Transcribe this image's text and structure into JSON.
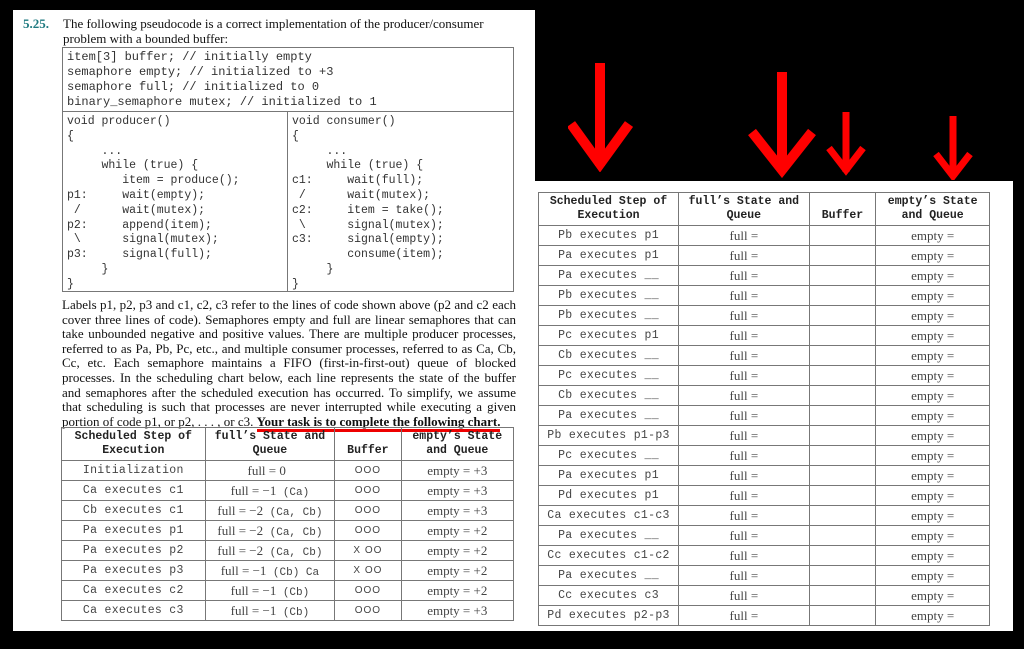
{
  "question": {
    "number": "5.25.",
    "text": "The following pseudocode is a correct implementation of the producer/consumer problem with a bounded buffer:"
  },
  "code": {
    "declarations": [
      "item[3] buffer; // initially empty",
      "semaphore empty; // initialized to +3",
      "semaphore full; // initialized to 0",
      "binary_semaphore mutex; // initialized to 1"
    ],
    "producer": [
      "void producer()",
      "{",
      "     ...",
      "     while (true) {",
      "        item = produce();",
      "p1:     wait(empty);",
      " /      wait(mutex);",
      "p2:     append(item);",
      " \\      signal(mutex);",
      "p3:     signal(full);",
      "     }",
      "}"
    ],
    "consumer": [
      "void consumer()",
      "{",
      "     ...",
      "     while (true) {",
      "c1:     wait(full);",
      " /      wait(mutex);",
      "c2:     item = take();",
      " \\      signal(mutex);",
      "c3:     signal(empty);",
      "        consume(item);",
      "     }",
      "}"
    ]
  },
  "paragraph": "Labels p1, p2, p3 and c1, c2, c3 refer to the lines of code shown above (p2 and c2 each cover three lines of code). Semaphores empty and full are linear semaphores that can take unbounded negative and positive values. There are multiple producer processes, referred to as Pa, Pb, Pc, etc., and multiple consumer processes, referred to as Ca, Cb, Cc, etc. Each semaphore maintains a FIFO (first-in-first-out) queue of blocked processes. In the scheduling chart below, each line represents the state of the buffer and semaphores after the scheduled execution has occurred. To simplify, we assume that scheduling is such that processes are never interrupted while executing a given portion of code p1, or p2, . . . , or c3.",
  "task": "Your task is to complete the following chart.",
  "annotation_color": "#ff0000",
  "table_headers": {
    "step": [
      "Scheduled Step of",
      "Execution"
    ],
    "full": [
      "full’s State and",
      "Queue"
    ],
    "buffer": [
      "Buffer"
    ],
    "empty": [
      "empty’s State",
      "and Queue"
    ]
  },
  "left_table": [
    {
      "step": "Initialization",
      "full": "full = 0",
      "full_queue": "",
      "buffer": "OOO",
      "empty": "empty = +3"
    },
    {
      "step": "Ca executes c1",
      "full": "full = −1",
      "full_queue": "(Ca)",
      "buffer": "OOO",
      "empty": "empty = +3"
    },
    {
      "step": "Cb executes c1",
      "full": "full = −2",
      "full_queue": "(Ca, Cb)",
      "buffer": "OOO",
      "empty": "empty = +3"
    },
    {
      "step": "Pa executes p1",
      "full": "full = −2",
      "full_queue": "(Ca, Cb)",
      "buffer": "OOO",
      "empty": "empty = +2"
    },
    {
      "step": "Pa executes p2",
      "full": "full = −2",
      "full_queue": "(Ca, Cb)",
      "buffer": "X OO",
      "empty": "empty = +2"
    },
    {
      "step": "Pa executes p3",
      "full": "full = −1",
      "full_queue": "(Cb) Ca",
      "buffer": "X OO",
      "empty": "empty = +2"
    },
    {
      "step": "Ca executes c2",
      "full": "full = −1",
      "full_queue": "(Cb)",
      "buffer": "OOO",
      "empty": "empty = +2"
    },
    {
      "step": "Ca executes c3",
      "full": "full = −1",
      "full_queue": "(Cb)",
      "buffer": "OOO",
      "empty": "empty = +3"
    }
  ],
  "right_table": [
    {
      "step": "Pb executes p1",
      "full": "full =",
      "buffer": "",
      "empty": "empty ="
    },
    {
      "step": "Pa executes p1",
      "full": "full =",
      "buffer": "",
      "empty": "empty ="
    },
    {
      "step": "Pa executes __",
      "full": "full =",
      "buffer": "",
      "empty": "empty ="
    },
    {
      "step": "Pb executes __",
      "full": "full =",
      "buffer": "",
      "empty": "empty ="
    },
    {
      "step": "Pb executes __",
      "full": "full =",
      "buffer": "",
      "empty": "empty ="
    },
    {
      "step": "Pc executes p1",
      "full": "full =",
      "buffer": "",
      "empty": "empty ="
    },
    {
      "step": "Cb executes __",
      "full": "full =",
      "buffer": "",
      "empty": "empty ="
    },
    {
      "step": "Pc executes __",
      "full": "full =",
      "buffer": "",
      "empty": "empty ="
    },
    {
      "step": "Cb executes __",
      "full": "full =",
      "buffer": "",
      "empty": "empty ="
    },
    {
      "step": "Pa executes __",
      "full": "full =",
      "buffer": "",
      "empty": "empty ="
    },
    {
      "step": "Pb executes p1-p3",
      "full": "full =",
      "buffer": "",
      "empty": "empty ="
    },
    {
      "step": "Pc executes __",
      "full": "full =",
      "buffer": "",
      "empty": "empty ="
    },
    {
      "step": "Pa executes p1",
      "full": "full =",
      "buffer": "",
      "empty": "empty ="
    },
    {
      "step": "Pd executes p1",
      "full": "full =",
      "buffer": "",
      "empty": "empty ="
    },
    {
      "step": "Ca executes c1-c3",
      "full": "full =",
      "buffer": "",
      "empty": "empty ="
    },
    {
      "step": "Pa executes __",
      "full": "full =",
      "buffer": "",
      "empty": "empty ="
    },
    {
      "step": "Cc executes c1-c2",
      "full": "full =",
      "buffer": "",
      "empty": "empty ="
    },
    {
      "step": "Pa executes __",
      "full": "full =",
      "buffer": "",
      "empty": "empty ="
    },
    {
      "step": "Cc executes c3",
      "full": "full =",
      "buffer": "",
      "empty": "empty ="
    },
    {
      "step": "Pd executes p2-p3",
      "full": "full =",
      "buffer": "",
      "empty": "empty ="
    }
  ],
  "arrows": [
    {
      "target": "step-column",
      "icon": "down-arrow-icon"
    },
    {
      "target": "full-column",
      "icon": "down-arrow-icon"
    },
    {
      "target": "buffer-column",
      "icon": "down-arrow-icon"
    },
    {
      "target": "empty-column",
      "icon": "down-arrow-icon"
    }
  ]
}
